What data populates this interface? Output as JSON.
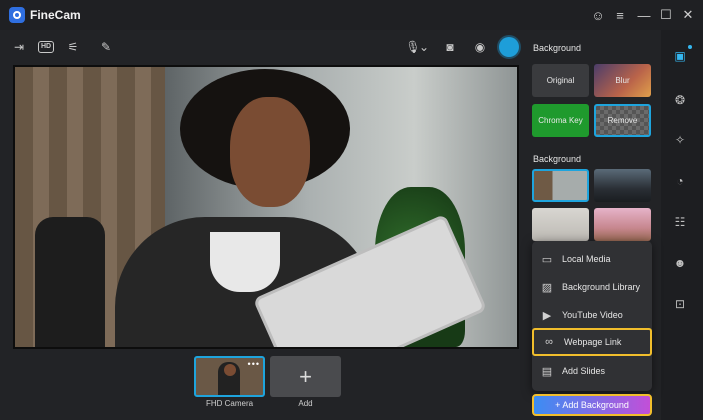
{
  "app": {
    "title": "FineCam"
  },
  "window_controls": [
    {
      "name": "account-icon",
      "glyph": "☺"
    },
    {
      "name": "menu-icon",
      "glyph": "≡"
    },
    {
      "name": "minimize-icon",
      "glyph": "—"
    },
    {
      "name": "maximize-icon",
      "glyph": "☐"
    },
    {
      "name": "close-icon",
      "glyph": "✕"
    }
  ],
  "toolbar": {
    "hd_label": "HD",
    "icons": [
      "mirror-icon",
      "hd-icon",
      "adjust-icon",
      "annotate-icon",
      "microphone-icon",
      "camera-snapshot-icon",
      "record-icon",
      "live-icon"
    ]
  },
  "sources": [
    {
      "label": "FHD Camera",
      "selected": true
    },
    {
      "label": "Add",
      "symbol": "+"
    }
  ],
  "panel": {
    "section1_title": "Background",
    "modes": [
      {
        "label": "Original"
      },
      {
        "label": "Blur"
      },
      {
        "label": "Chroma Key"
      },
      {
        "label": "Remove",
        "selected": true
      }
    ],
    "section2_title": "Background"
  },
  "menu": {
    "items": [
      {
        "label": "Local Media",
        "icon": "folder-icon"
      },
      {
        "label": "Background Library",
        "icon": "image-icon"
      },
      {
        "label": "YouTube Video",
        "icon": "youtube-icon"
      },
      {
        "label": "Webpage Link",
        "icon": "link-icon",
        "highlighted": true
      },
      {
        "label": "Add Slides",
        "icon": "slides-icon"
      }
    ],
    "add_background": "+ Add Background"
  },
  "colors": {
    "accent": "#1ea4dd",
    "highlight": "#f1be2c",
    "chroma": "#1f9a2d"
  }
}
